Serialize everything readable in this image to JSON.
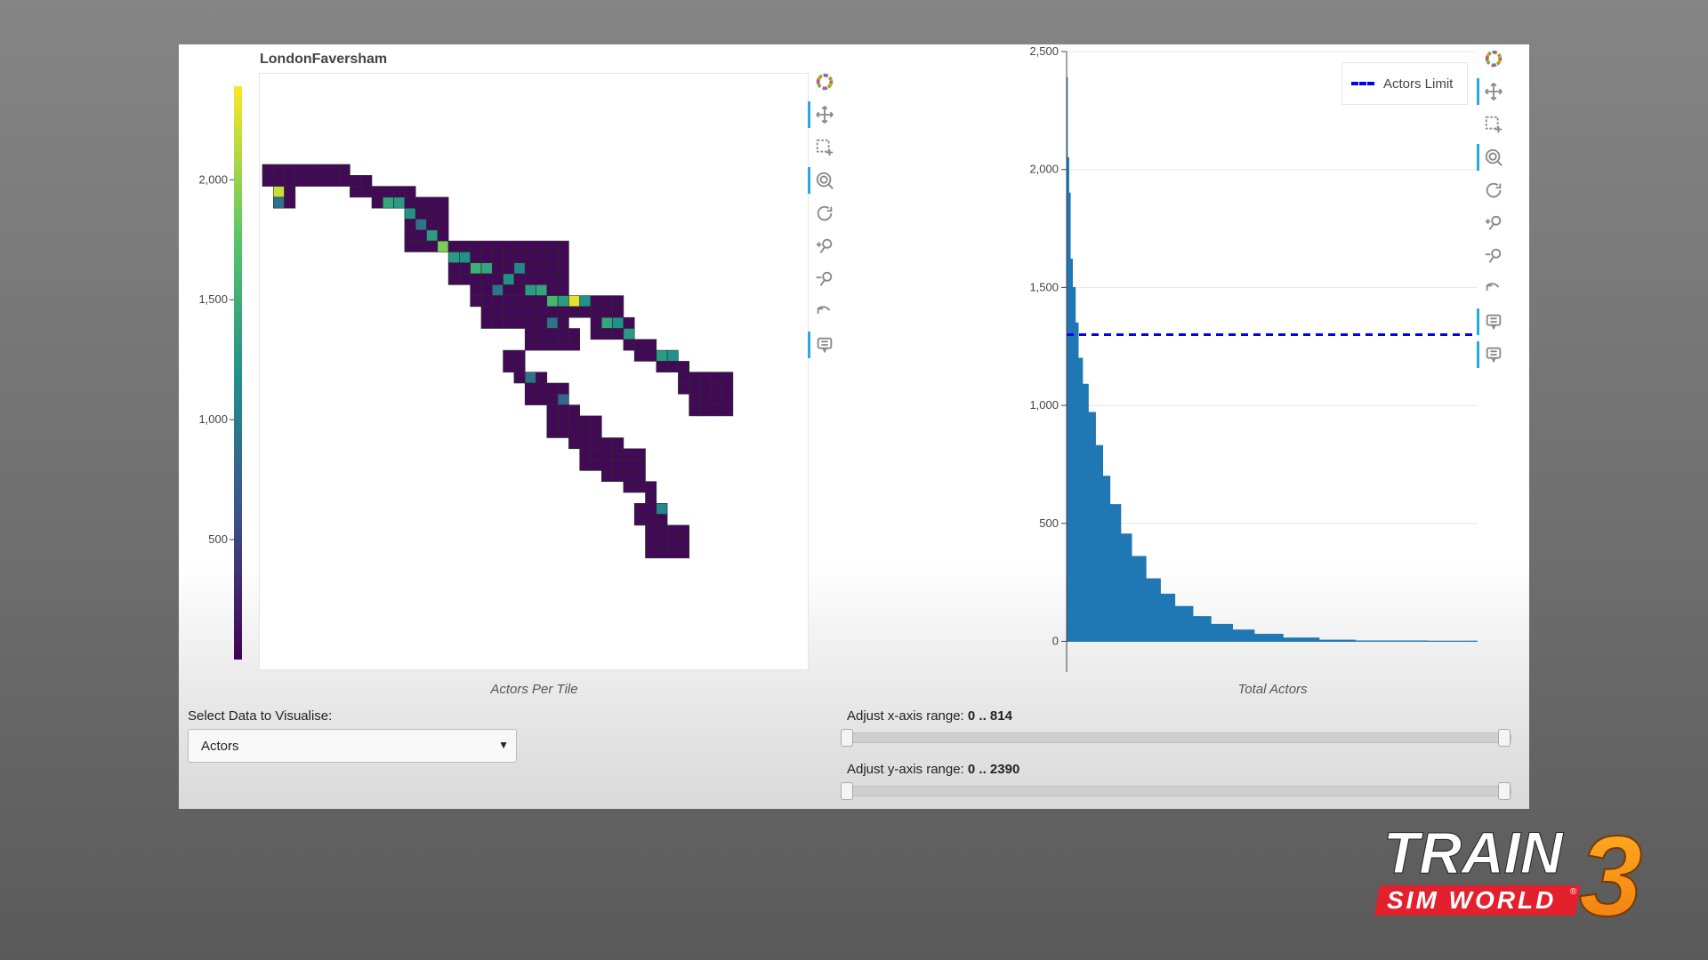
{
  "heatmap": {
    "title": "LondonFaversham",
    "caption": "Actors Per Tile",
    "colorbar_ticks": [
      "2,000",
      "1,500",
      "1,000",
      "500"
    ],
    "colorbar_tick_values": [
      2000,
      1500,
      1000,
      500
    ],
    "colorbar_range": [
      0,
      2390
    ],
    "colormap": [
      "#440154",
      "#3b528b",
      "#21918c",
      "#5ec962",
      "#fde725"
    ],
    "tile_base_color": "#420a56",
    "tile_edge_color": "#2a2a2a"
  },
  "bar_chart": {
    "caption": "Total Actors",
    "y_ticks": [
      "2,500",
      "2,000",
      "1,500",
      "1,000",
      "500",
      "0"
    ],
    "legend_label": "Actors Limit",
    "line_color": "#0000ee",
    "area_color": "#1f77b4"
  },
  "toolbar_icons": [
    "bokeh-logo-icon",
    "pan-icon",
    "box-zoom-icon",
    "wheel-zoom-icon",
    "reset-icon",
    "zoom-in-icon",
    "zoom-out-icon",
    "undo-icon",
    "hover-icon"
  ],
  "controls": {
    "select_label": "Select Data to Visualise:",
    "select_value": "Actors",
    "x_range_label": "Adjust x-axis range: ",
    "x_range_value": "0 .. 814",
    "y_range_label": "Adjust y-axis range: ",
    "y_range_value": "0 .. 2390"
  },
  "logo": {
    "line1": "TRAIN",
    "line2": "SIM WORLD",
    "number": "3",
    "registered": "®"
  },
  "chart_data": [
    {
      "type": "heatmap",
      "title": "LondonFaversham",
      "xlabel": "Actors Per Tile",
      "legend": "colorbar left, range 0–2390",
      "grid_regions": [
        {
          "col_range": [
            0,
            8
          ],
          "row_range": [
            0,
            2
          ],
          "value": 30
        },
        {
          "col_range": [
            1,
            3
          ],
          "row_range": [
            2,
            4
          ],
          "value": 30
        },
        {
          "col_range": [
            8,
            10
          ],
          "row_range": [
            1,
            3
          ],
          "value": 30
        },
        {
          "col_range": [
            10,
            14
          ],
          "row_range": [
            2,
            4
          ],
          "value": 30
        },
        {
          "col_range": [
            13,
            17
          ],
          "row_range": [
            3,
            5
          ],
          "value": 30
        },
        {
          "col_range": [
            13,
            17
          ],
          "row_range": [
            5,
            8
          ],
          "value": 30
        },
        {
          "col_range": [
            17,
            22
          ],
          "row_range": [
            7,
            9
          ],
          "value": 30
        },
        {
          "col_range": [
            17,
            24
          ],
          "row_range": [
            9,
            11
          ],
          "value": 30
        },
        {
          "col_range": [
            19,
            24
          ],
          "row_range": [
            11,
            13
          ],
          "value": 30
        },
        {
          "col_range": [
            21,
            28
          ],
          "row_range": [
            7,
            13
          ],
          "value": 30
        },
        {
          "col_range": [
            20,
            28
          ],
          "row_range": [
            13,
            15
          ],
          "value": 30
        },
        {
          "col_range": [
            24,
            29
          ],
          "row_range": [
            15,
            17
          ],
          "value": 30
        },
        {
          "col_range": [
            28,
            33
          ],
          "row_range": [
            12,
            14
          ],
          "value": 30
        },
        {
          "col_range": [
            30,
            34
          ],
          "row_range": [
            14,
            16
          ],
          "value": 30
        },
        {
          "col_range": [
            33,
            36
          ],
          "row_range": [
            16,
            17
          ],
          "value": 30
        },
        {
          "col_range": [
            34,
            38
          ],
          "row_range": [
            17,
            18
          ],
          "value": 30
        },
        {
          "col_range": [
            36,
            39
          ],
          "row_range": [
            18,
            19
          ],
          "value": 30
        },
        {
          "col_range": [
            38,
            43
          ],
          "row_range": [
            19,
            21
          ],
          "value": 30
        },
        {
          "col_range": [
            39,
            43
          ],
          "row_range": [
            21,
            23
          ],
          "value": 30
        },
        {
          "col_range": [
            22,
            24
          ],
          "row_range": [
            17,
            19
          ],
          "value": 30
        },
        {
          "col_range": [
            23,
            26
          ],
          "row_range": [
            19,
            20
          ],
          "value": 30
        },
        {
          "col_range": [
            24,
            28
          ],
          "row_range": [
            20,
            22
          ],
          "value": 30
        },
        {
          "col_range": [
            26,
            29
          ],
          "row_range": [
            22,
            23
          ],
          "value": 30
        },
        {
          "col_range": [
            26,
            31
          ],
          "row_range": [
            23,
            25
          ],
          "value": 30
        },
        {
          "col_range": [
            28,
            33
          ],
          "row_range": [
            25,
            26
          ],
          "value": 30
        },
        {
          "col_range": [
            29,
            35
          ],
          "row_range": [
            26,
            28
          ],
          "value": 30
        },
        {
          "col_range": [
            31,
            35
          ],
          "row_range": [
            28,
            29
          ],
          "value": 30
        },
        {
          "col_range": [
            33,
            36
          ],
          "row_range": [
            29,
            30
          ],
          "value": 30
        },
        {
          "col_range": [
            35,
            36
          ],
          "row_range": [
            30,
            32
          ],
          "value": 30
        },
        {
          "col_range": [
            34,
            37
          ],
          "row_range": [
            31,
            33
          ],
          "value": 30
        },
        {
          "col_range": [
            35,
            39
          ],
          "row_range": [
            33,
            36
          ],
          "value": 30
        }
      ],
      "highlights": [
        {
          "col": 1,
          "row": 2,
          "value": 2200
        },
        {
          "col": 1,
          "row": 3,
          "value": 900
        },
        {
          "col": 6,
          "row": 2,
          "value": 700
        },
        {
          "col": 11,
          "row": 3,
          "value": 1400
        },
        {
          "col": 12,
          "row": 3,
          "value": 1300
        },
        {
          "col": 13,
          "row": 4,
          "value": 1200
        },
        {
          "col": 14,
          "row": 5,
          "value": 900
        },
        {
          "col": 15,
          "row": 6,
          "value": 1300
        },
        {
          "col": 16,
          "row": 7,
          "value": 1900
        },
        {
          "col": 15,
          "row": 8,
          "value": 1500
        },
        {
          "col": 14,
          "row": 8,
          "value": 1400
        },
        {
          "col": 13,
          "row": 8,
          "value": 1200
        },
        {
          "col": 17,
          "row": 8,
          "value": 1300
        },
        {
          "col": 18,
          "row": 8,
          "value": 1200
        },
        {
          "col": 19,
          "row": 9,
          "value": 1500
        },
        {
          "col": 20,
          "row": 9,
          "value": 1400
        },
        {
          "col": 22,
          "row": 10,
          "value": 1200
        },
        {
          "col": 23,
          "row": 9,
          "value": 1100
        },
        {
          "col": 21,
          "row": 11,
          "value": 900
        },
        {
          "col": 24,
          "row": 11,
          "value": 1300
        },
        {
          "col": 25,
          "row": 11,
          "value": 1400
        },
        {
          "col": 26,
          "row": 12,
          "value": 1600
        },
        {
          "col": 27,
          "row": 12,
          "value": 1300
        },
        {
          "col": 28,
          "row": 12,
          "value": 2300
        },
        {
          "col": 29,
          "row": 12,
          "value": 1200
        },
        {
          "col": 26,
          "row": 14,
          "value": 900
        },
        {
          "col": 31,
          "row": 14,
          "value": 1400
        },
        {
          "col": 32,
          "row": 14,
          "value": 1200
        },
        {
          "col": 33,
          "row": 15,
          "value": 1300
        },
        {
          "col": 36,
          "row": 17,
          "value": 1300
        },
        {
          "col": 37,
          "row": 17,
          "value": 1200
        },
        {
          "col": 24,
          "row": 19,
          "value": 900
        },
        {
          "col": 27,
          "row": 21,
          "value": 800
        },
        {
          "col": 31,
          "row": 24,
          "value": 700
        },
        {
          "col": 37,
          "row": 30,
          "value": 1000
        },
        {
          "col": 38,
          "row": 30,
          "value": 1400
        },
        {
          "col": 36,
          "row": 31,
          "value": 1100
        },
        {
          "col": 38,
          "row": 32,
          "value": 800
        }
      ]
    },
    {
      "type": "area",
      "title": "",
      "xlabel": "Total Actors",
      "ylabel": "",
      "xlim": [
        0,
        814
      ],
      "ylim": [
        -130,
        2500
      ],
      "y_ticks": [
        0,
        500,
        1000,
        1500,
        2000,
        2500
      ],
      "grid": true,
      "legend": "top-right",
      "x": [
        0,
        1,
        3,
        5,
        8,
        12,
        16,
        22,
        30,
        40,
        50,
        60,
        75,
        90,
        110,
        130,
        150,
        175,
        200,
        230,
        260,
        300,
        350,
        400,
        500,
        600,
        700,
        814
      ],
      "values": [
        2390,
        2050,
        1900,
        1620,
        1500,
        1350,
        1200,
        1090,
        970,
        830,
        700,
        580,
        455,
        360,
        265,
        200,
        148,
        105,
        72,
        48,
        30,
        14,
        5,
        2,
        1,
        0,
        0,
        0
      ],
      "series": [
        {
          "name": "Actors Limit",
          "style": "dashed",
          "y": 1300
        }
      ]
    }
  ]
}
